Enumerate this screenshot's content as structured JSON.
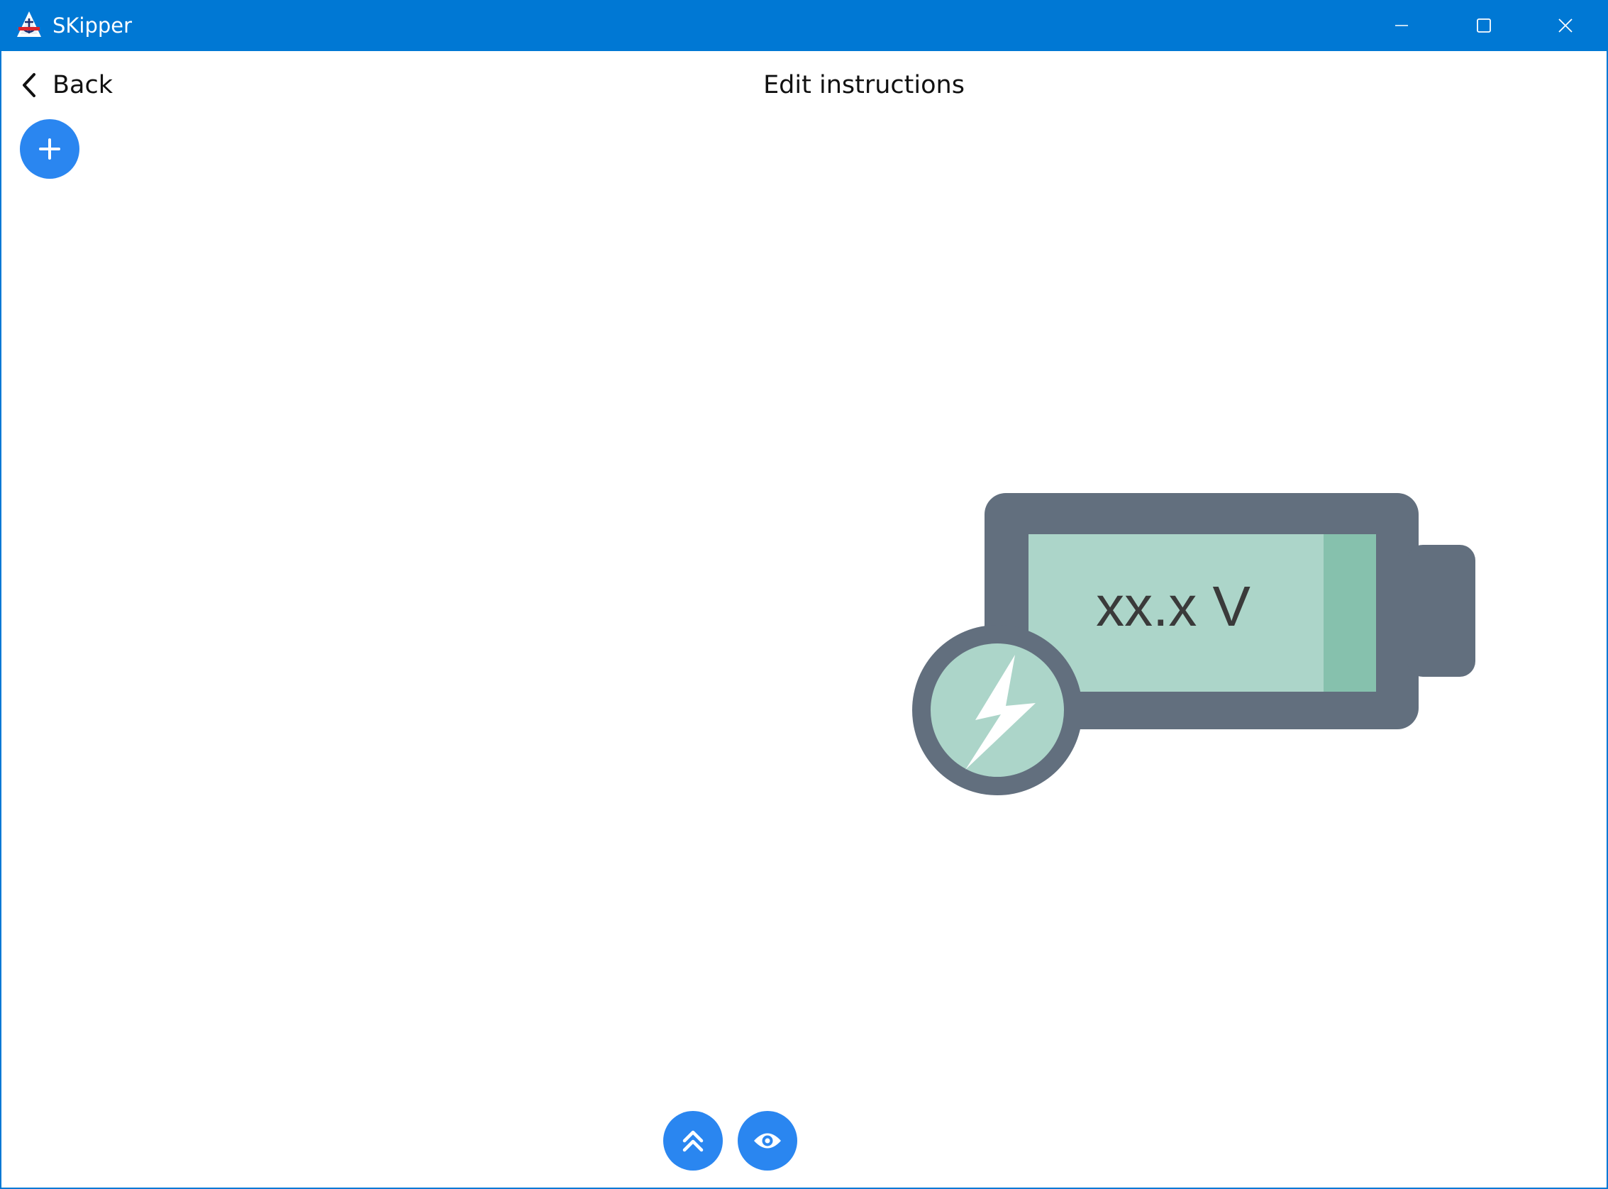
{
  "window": {
    "title": "SKipper",
    "accent_color": "#0078d4",
    "controls": [
      "minimize-icon",
      "maximize-icon",
      "close-icon"
    ]
  },
  "header": {
    "back_label": "Back",
    "back_icon": "chevron-left-icon",
    "title": "Edit instructions"
  },
  "toolbar": {
    "add_icon": "plus-icon",
    "button_color": "#2a86f0"
  },
  "bottom_actions": {
    "move_up_icon": "double-chevron-up-icon",
    "preview_icon": "eye-icon"
  },
  "battery_widget": {
    "voltage_text": "xx.x V",
    "icon": "lightning-bolt-icon",
    "frame_color": "#626f7e",
    "fill_color": "#acd5c9",
    "fill_accent_color": "#86c1ad"
  }
}
